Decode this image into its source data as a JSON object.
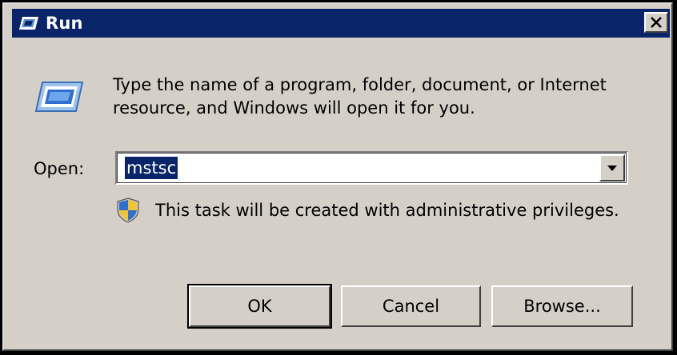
{
  "window": {
    "title": "Run",
    "title_icon": "run-icon",
    "close_icon": "close-icon"
  },
  "main": {
    "app_icon": "run-program-icon",
    "description": "Type the name of a program, folder, document, or Internet resource, and Windows will open it for you.",
    "open_label": "Open:",
    "open_value": "mstsc",
    "open_value_selected": true,
    "dropdown_icon": "chevron-down-icon",
    "admin_icon": "uac-shield-icon",
    "admin_notice": "This task will be created with administrative privileges."
  },
  "buttons": {
    "ok": "OK",
    "cancel": "Cancel",
    "browse": "Browse..."
  },
  "colors": {
    "titlebar": "#0a246a",
    "face": "#d4d0c8",
    "selection": "#0a246a"
  }
}
